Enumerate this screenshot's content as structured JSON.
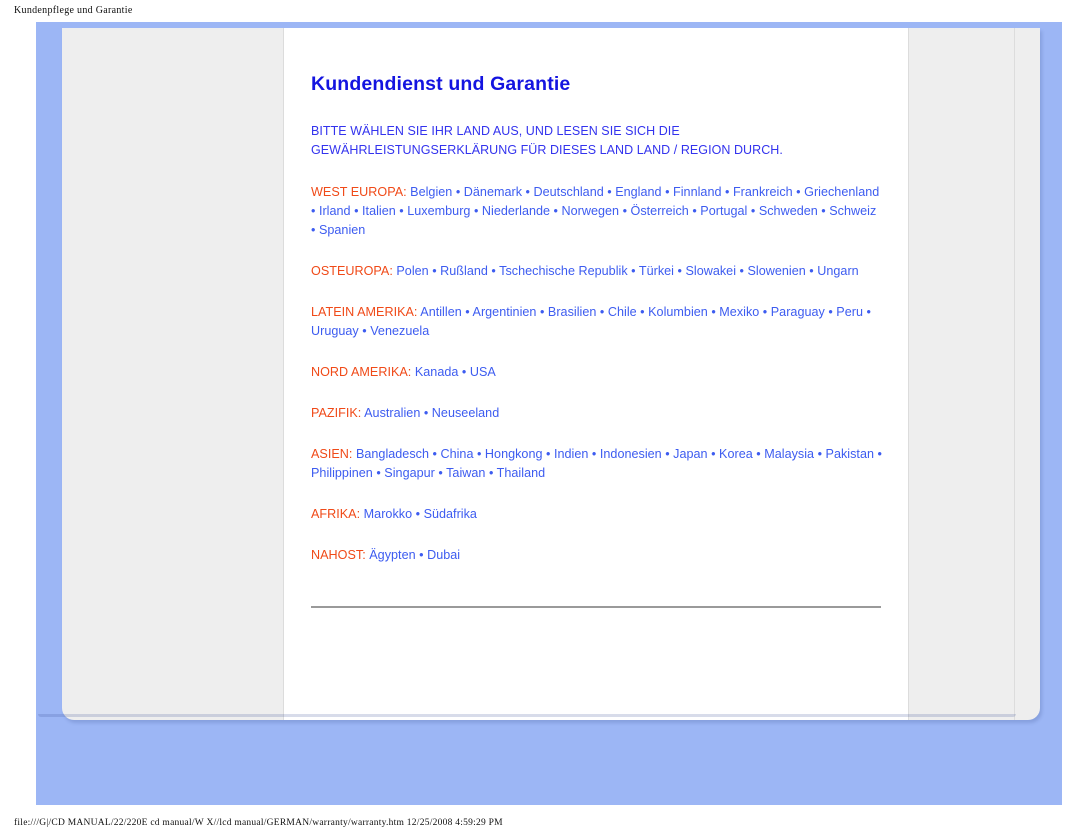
{
  "print": {
    "header": "Kundenpflege und Garantie",
    "footer": "file:///G|/CD MANUAL/22/220E cd manual/W X//lcd manual/GERMAN/warranty/warranty.htm 12/25/2008 4:59:29 PM"
  },
  "colors": {
    "page_background": "#9cb6f5",
    "panel_background": "#eeeeee",
    "column_background": "#ffffff",
    "title": "#1414e0",
    "lead_text": "#3333ee",
    "region_label": "#f04a18",
    "country_link": "#3d5cf0",
    "divider": "#9a9a9a"
  },
  "document": {
    "title": "Kundendienst und Garantie",
    "lead": "BITTE WÄHLEN SIE IHR LAND AUS, UND LESEN SIE SICH DIE GEWÄHRLEISTUNGSERKLÄRUNG FÜR DIESES LAND LAND / REGION DURCH.",
    "separator": "•",
    "regions": [
      {
        "label": "WEST EUROPA:",
        "countries": "Belgien • Dänemark • Deutschland • England • Finnland • Frankreich • Griechenland • Irland • Italien • Luxemburg • Niederlande • Norwegen • Österreich • Portugal • Schweden • Schweiz • Spanien"
      },
      {
        "label": "OSTEUROPA:",
        "countries": "Polen • Rußland • Tschechische Republik • Türkei • Slowakei • Slowenien • Ungarn"
      },
      {
        "label": "LATEIN AMERIKA:",
        "countries": "Antillen • Argentinien • Brasilien • Chile • Kolumbien • Mexiko • Paraguay • Peru • Uruguay • Venezuela"
      },
      {
        "label": "NORD AMERIKA:",
        "countries": "Kanada • USA"
      },
      {
        "label": "PAZIFIK:",
        "countries": "Australien • Neuseeland"
      },
      {
        "label": "ASIEN:",
        "countries": "Bangladesch • China • Hongkong • Indien • Indonesien • Japan • Korea • Malaysia • Pakistan • Philippinen • Singapur • Taiwan • Thailand"
      },
      {
        "label": "AFRIKA:",
        "countries": "Marokko • Südafrika"
      },
      {
        "label": "NAHOST:",
        "countries": "Ägypten • Dubai"
      }
    ]
  }
}
